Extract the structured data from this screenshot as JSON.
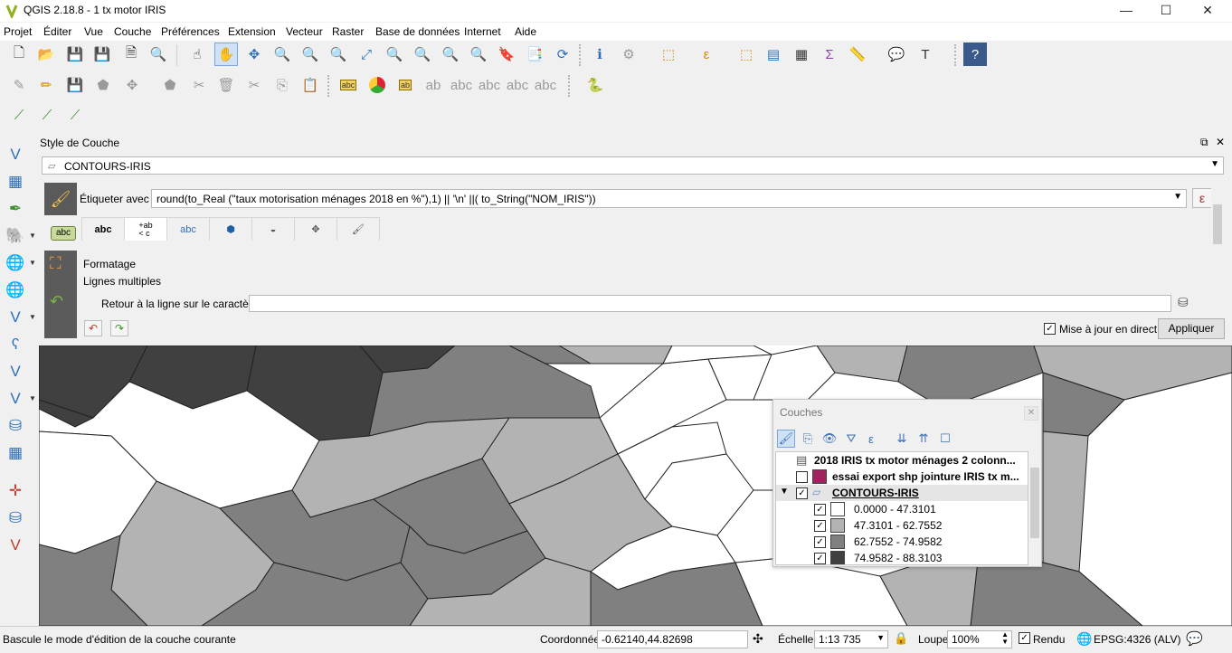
{
  "window": {
    "title": "QGIS 2.18.8 - 1 tx motor IRIS",
    "controls": {
      "minimize": "—",
      "maximize": "☐",
      "close": "✕"
    }
  },
  "menu": [
    "Projet",
    "Éditer",
    "Vue",
    "Couche",
    "Préférences",
    "Extension",
    "Vecteur",
    "Raster",
    "Base de données",
    "Internet",
    "Aide"
  ],
  "dock": {
    "title": "Style de Couche",
    "controls": {
      "float": "⧉",
      "close": "✕"
    },
    "layer_selected": "CONTOURS-IRIS",
    "label_with": "Étiqueter avec",
    "expression": "round(to_Real (\"taux motorisation ménages 2018 en %\"),1)  ||  '\\n'  ||( to_String(\"NOM_IRIS\"))",
    "epsilon_symbol": "ε",
    "abc_chip": "abc",
    "tabs": [
      "abc",
      "+ab\n< c",
      "abc",
      "",
      "",
      "",
      ""
    ],
    "section_formatage": "Formatage",
    "section_lignes": "Lignes multiples",
    "wrap_label": "Retour à la ligne sur le caractère",
    "wrap_value": "",
    "live_update_label": "Mise à jour en direct",
    "live_update_checked": true,
    "apply_label": "Appliquer"
  },
  "couches": {
    "title": "Couches",
    "layers": [
      {
        "name": "2018 IRIS tx motor ménages 2 colonn...",
        "type": "table"
      },
      {
        "name": "essai export shp jointure IRIS tx m...",
        "checked": false,
        "color": "#a0225e"
      },
      {
        "name": "CONTOURS-IRIS",
        "checked": true,
        "expanded": true
      },
      {
        "name": "0.0000 - 47.3101",
        "checked": true,
        "color": "#ffffff"
      },
      {
        "name": "47.3101 - 62.7552",
        "checked": true,
        "color": "#b3b3b3"
      },
      {
        "name": "62.7552 - 74.9582",
        "checked": true,
        "color": "#808080"
      },
      {
        "name": "74.9582 - 88.3103",
        "checked": true,
        "color": "#404040"
      }
    ]
  },
  "status": {
    "message": "Bascule le mode d'édition de la couche courante",
    "coord_label": "Coordonnée",
    "coord_value": "-0.62140,44.82698",
    "scale_label": "Échelle",
    "scale_value": "1:13 735",
    "magnifier_label": "Loupe",
    "magnifier_value": "100%",
    "render_label": "Rendu",
    "render_checked": true,
    "crs": "EPSG:4326 (ALV)"
  },
  "colors": {
    "class1": "#ffffff",
    "class2": "#b3b3b3",
    "class3": "#808080",
    "class4": "#404040"
  }
}
